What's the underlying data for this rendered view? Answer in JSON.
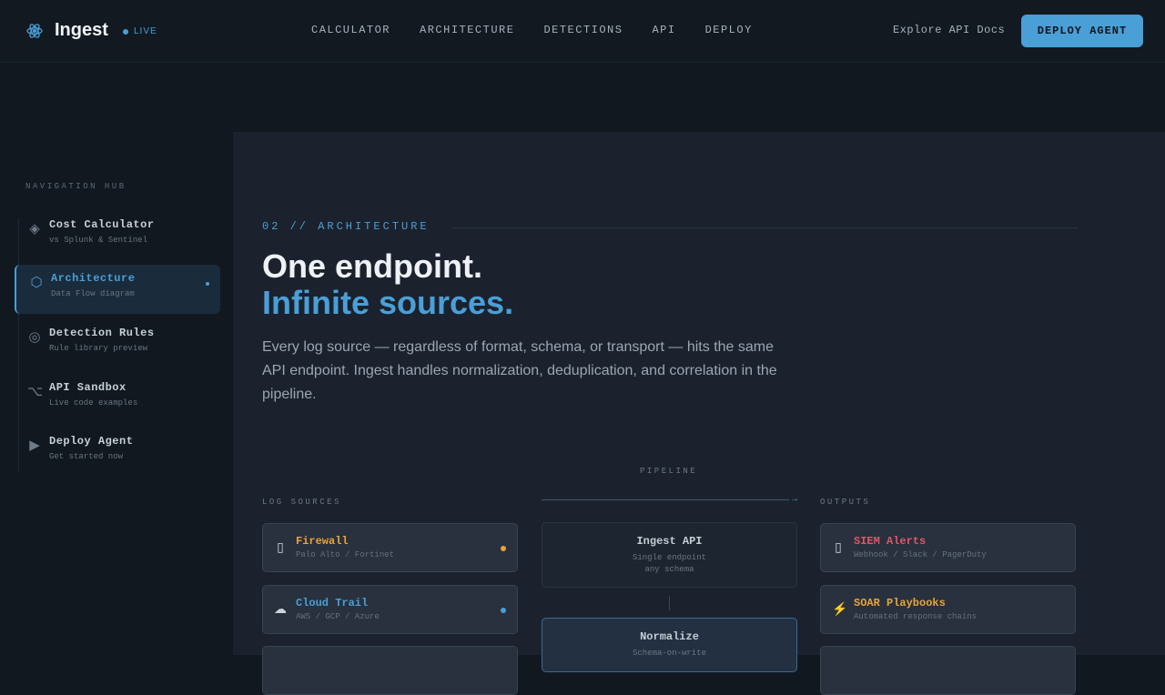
{
  "header": {
    "brand": "Ingest",
    "live_label": "LIVE",
    "nav": [
      "CALCULATOR",
      "ARCHITECTURE",
      "DETECTIONS",
      "API",
      "DEPLOY"
    ],
    "explore_link": "Explore API Docs",
    "deploy_button": "DEPLOY AGENT"
  },
  "sidebar": {
    "title": "NAVIGATION HUB",
    "items": [
      {
        "label": "Cost Calculator",
        "sub": "vs Splunk & Sentinel",
        "icon": "diamond-icon",
        "glyph": "◈",
        "active": false
      },
      {
        "label": "Architecture",
        "sub": "Data Flow diagram",
        "icon": "hexagon-icon",
        "glyph": "⬡",
        "active": true
      },
      {
        "label": "Detection Rules",
        "sub": "Rule library preview",
        "icon": "target-icon",
        "glyph": "◎",
        "active": false
      },
      {
        "label": "API Sandbox",
        "sub": "Live code examples",
        "icon": "option-key-icon",
        "glyph": "⌥",
        "active": false
      },
      {
        "label": "Deploy Agent",
        "sub": "Get started now",
        "icon": "play-icon",
        "glyph": "▶",
        "active": false
      }
    ]
  },
  "main": {
    "section_tag": "02 // ARCHITECTURE",
    "headline_1": "One endpoint.",
    "headline_2": "Infinite sources.",
    "lead": "Every log source — regardless of format, schema, or transport — hits the same API endpoint. Ingest handles normalization, deduplication, and correlation in the pipeline.",
    "pipeline_label": "PIPELINE",
    "sources_label": "LOG SOURCES",
    "outputs_label": "OUTPUTS",
    "sources": [
      {
        "title": "Firewall",
        "sub": "Palo Alto / Fortinet",
        "icon": "firewall-icon",
        "glyph": "▯",
        "color": "#e8a33c",
        "dot": "#e8a33c"
      },
      {
        "title": "Cloud Trail",
        "sub": "AWS / GCP / Azure",
        "icon": "cloud-icon",
        "glyph": "☁",
        "color": "#4a9fd6",
        "dot": "#4a9fd6"
      }
    ],
    "stages": [
      {
        "title": "Ingest API",
        "sub1": "Single endpoint",
        "sub2": "any schema"
      },
      {
        "title": "Normalize",
        "sub1": "Schema-on-write"
      }
    ],
    "outputs": [
      {
        "title": "SIEM Alerts",
        "sub": "Webhook / Slack / PagerDuty",
        "icon": "siem-icon",
        "glyph": "▯",
        "color": "#e0566a"
      },
      {
        "title": "SOAR Playbooks",
        "sub": "Automated response chains",
        "icon": "lightning-icon",
        "glyph": "⚡",
        "color": "#e8a33c"
      }
    ]
  }
}
